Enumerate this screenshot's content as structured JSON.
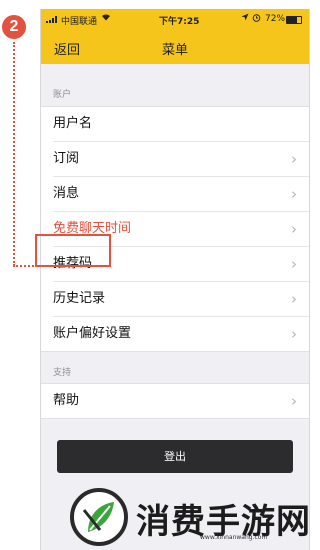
{
  "step": {
    "number": "2",
    "color": "#e2533f"
  },
  "status_bar": {
    "carrier": "中国联通",
    "wifi_icon": "wifi-icon",
    "time": "下午7:25",
    "location_icon": "location-arrow-icon",
    "alarm_icon": "alarm-clock-icon",
    "battery_percent": "72%",
    "battery_level": 0.72
  },
  "nav": {
    "back_label": "返回",
    "title": "菜单",
    "accent_color": "#f5c51b"
  },
  "sections": [
    {
      "header": "账户",
      "rows": [
        {
          "label": "用户名",
          "chevron": false
        },
        {
          "label": "订阅",
          "chevron": true
        },
        {
          "label": "消息",
          "chevron": true
        },
        {
          "label": "免费聊天时间",
          "chevron": true,
          "color": "#e2533f"
        },
        {
          "label": "推荐码",
          "chevron": true,
          "highlighted": true
        },
        {
          "label": "历史记录",
          "chevron": true
        },
        {
          "label": "账户偏好设置",
          "chevron": true
        }
      ]
    },
    {
      "header": "支持",
      "rows": [
        {
          "label": "帮助",
          "chevron": true
        }
      ]
    }
  ],
  "chevron_glyph": "›",
  "logout_label": "登出",
  "watermark": {
    "title": "消费手游网",
    "url": "www.xinnanwang.com",
    "logo": "leaf-logo"
  }
}
